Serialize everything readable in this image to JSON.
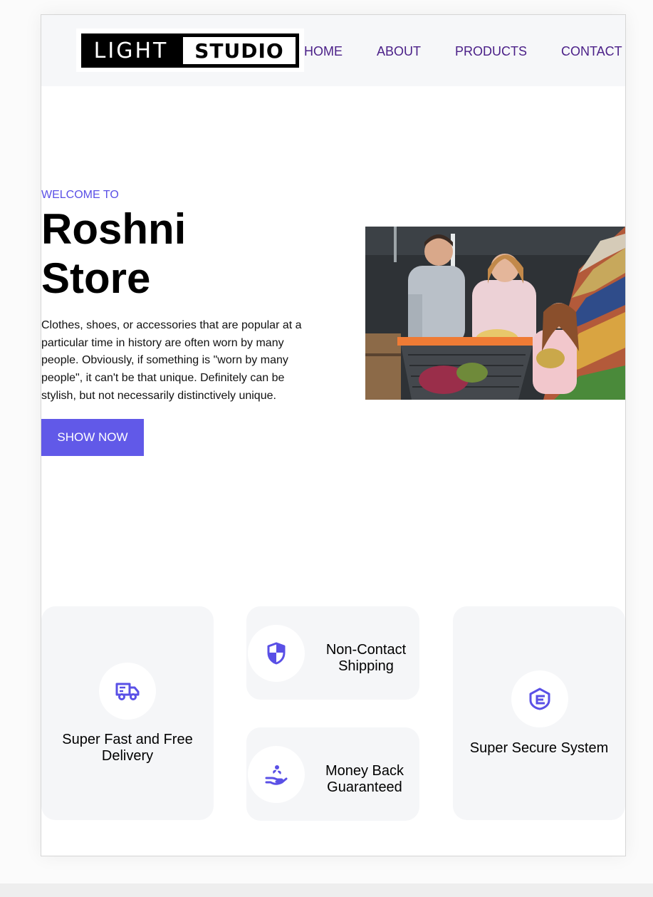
{
  "brand": {
    "logo_left": "LIGHT",
    "logo_right": "STUDIO",
    "accent": "#6159e8",
    "nav_color": "#4b2088"
  },
  "nav": {
    "home": "HOME",
    "about": "ABOUT",
    "products": "PRODUCTS",
    "contact": "CONTACT"
  },
  "hero": {
    "welcome": "WELCOME TO",
    "title_line1": "Roshni",
    "title_line2": "Store",
    "description": "Clothes, shoes, or accessories that are popular at a particular time in history are often worn by many people. Obviously, if something is \"worn by many people\", it can't be that unique. Definitely can be stylish, but not necessarily distinctively unique.",
    "cta_label": "SHOW NOW"
  },
  "features": {
    "delivery": {
      "line1": "Super Fast and Free",
      "line2": "Delivery",
      "icon": "truck-icon"
    },
    "shipping": {
      "line1": "Non-Contact",
      "line2": "Shipping",
      "icon": "shield-icon"
    },
    "money_back": {
      "line1": "Money Back",
      "line2": "Guaranteed",
      "icon": "hand-coin-icon"
    },
    "secure": {
      "label": "Super Secure System",
      "icon": "secure-shield-icon"
    }
  }
}
